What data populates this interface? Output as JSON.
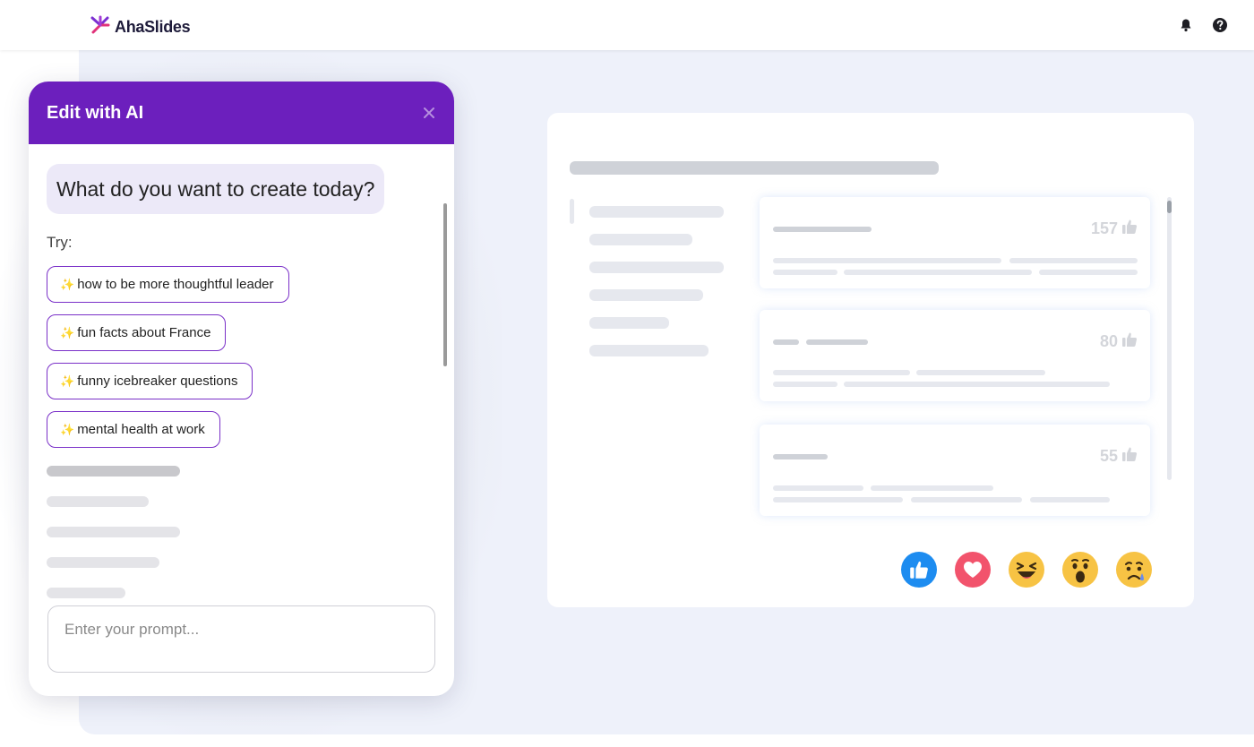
{
  "header": {
    "brand": "AhaSlides"
  },
  "ai_panel": {
    "title": "Edit with AI",
    "question": "What do you want to create today?",
    "try_label": "Try:",
    "spark": "✨",
    "suggestions": [
      "how to be more thoughtful leader",
      "fun facts about France",
      "funny icebreaker questions",
      "mental health at work"
    ],
    "prompt_placeholder": "Enter your prompt..."
  },
  "slide": {
    "cards": [
      {
        "count": "157"
      },
      {
        "count": "80"
      },
      {
        "count": "55"
      }
    ],
    "reactions": [
      "thumbs-up",
      "heart",
      "laughing-face",
      "surprised-face",
      "crying-face"
    ]
  },
  "colors": {
    "accent_purple": "#6c1fbd",
    "chip_border": "#7a30c8",
    "canvas_bg": "#eef1fa",
    "like_blue": "#1d8cf0",
    "heart_pink": "#f2536c",
    "emoji_yellow": "#f7c344"
  }
}
